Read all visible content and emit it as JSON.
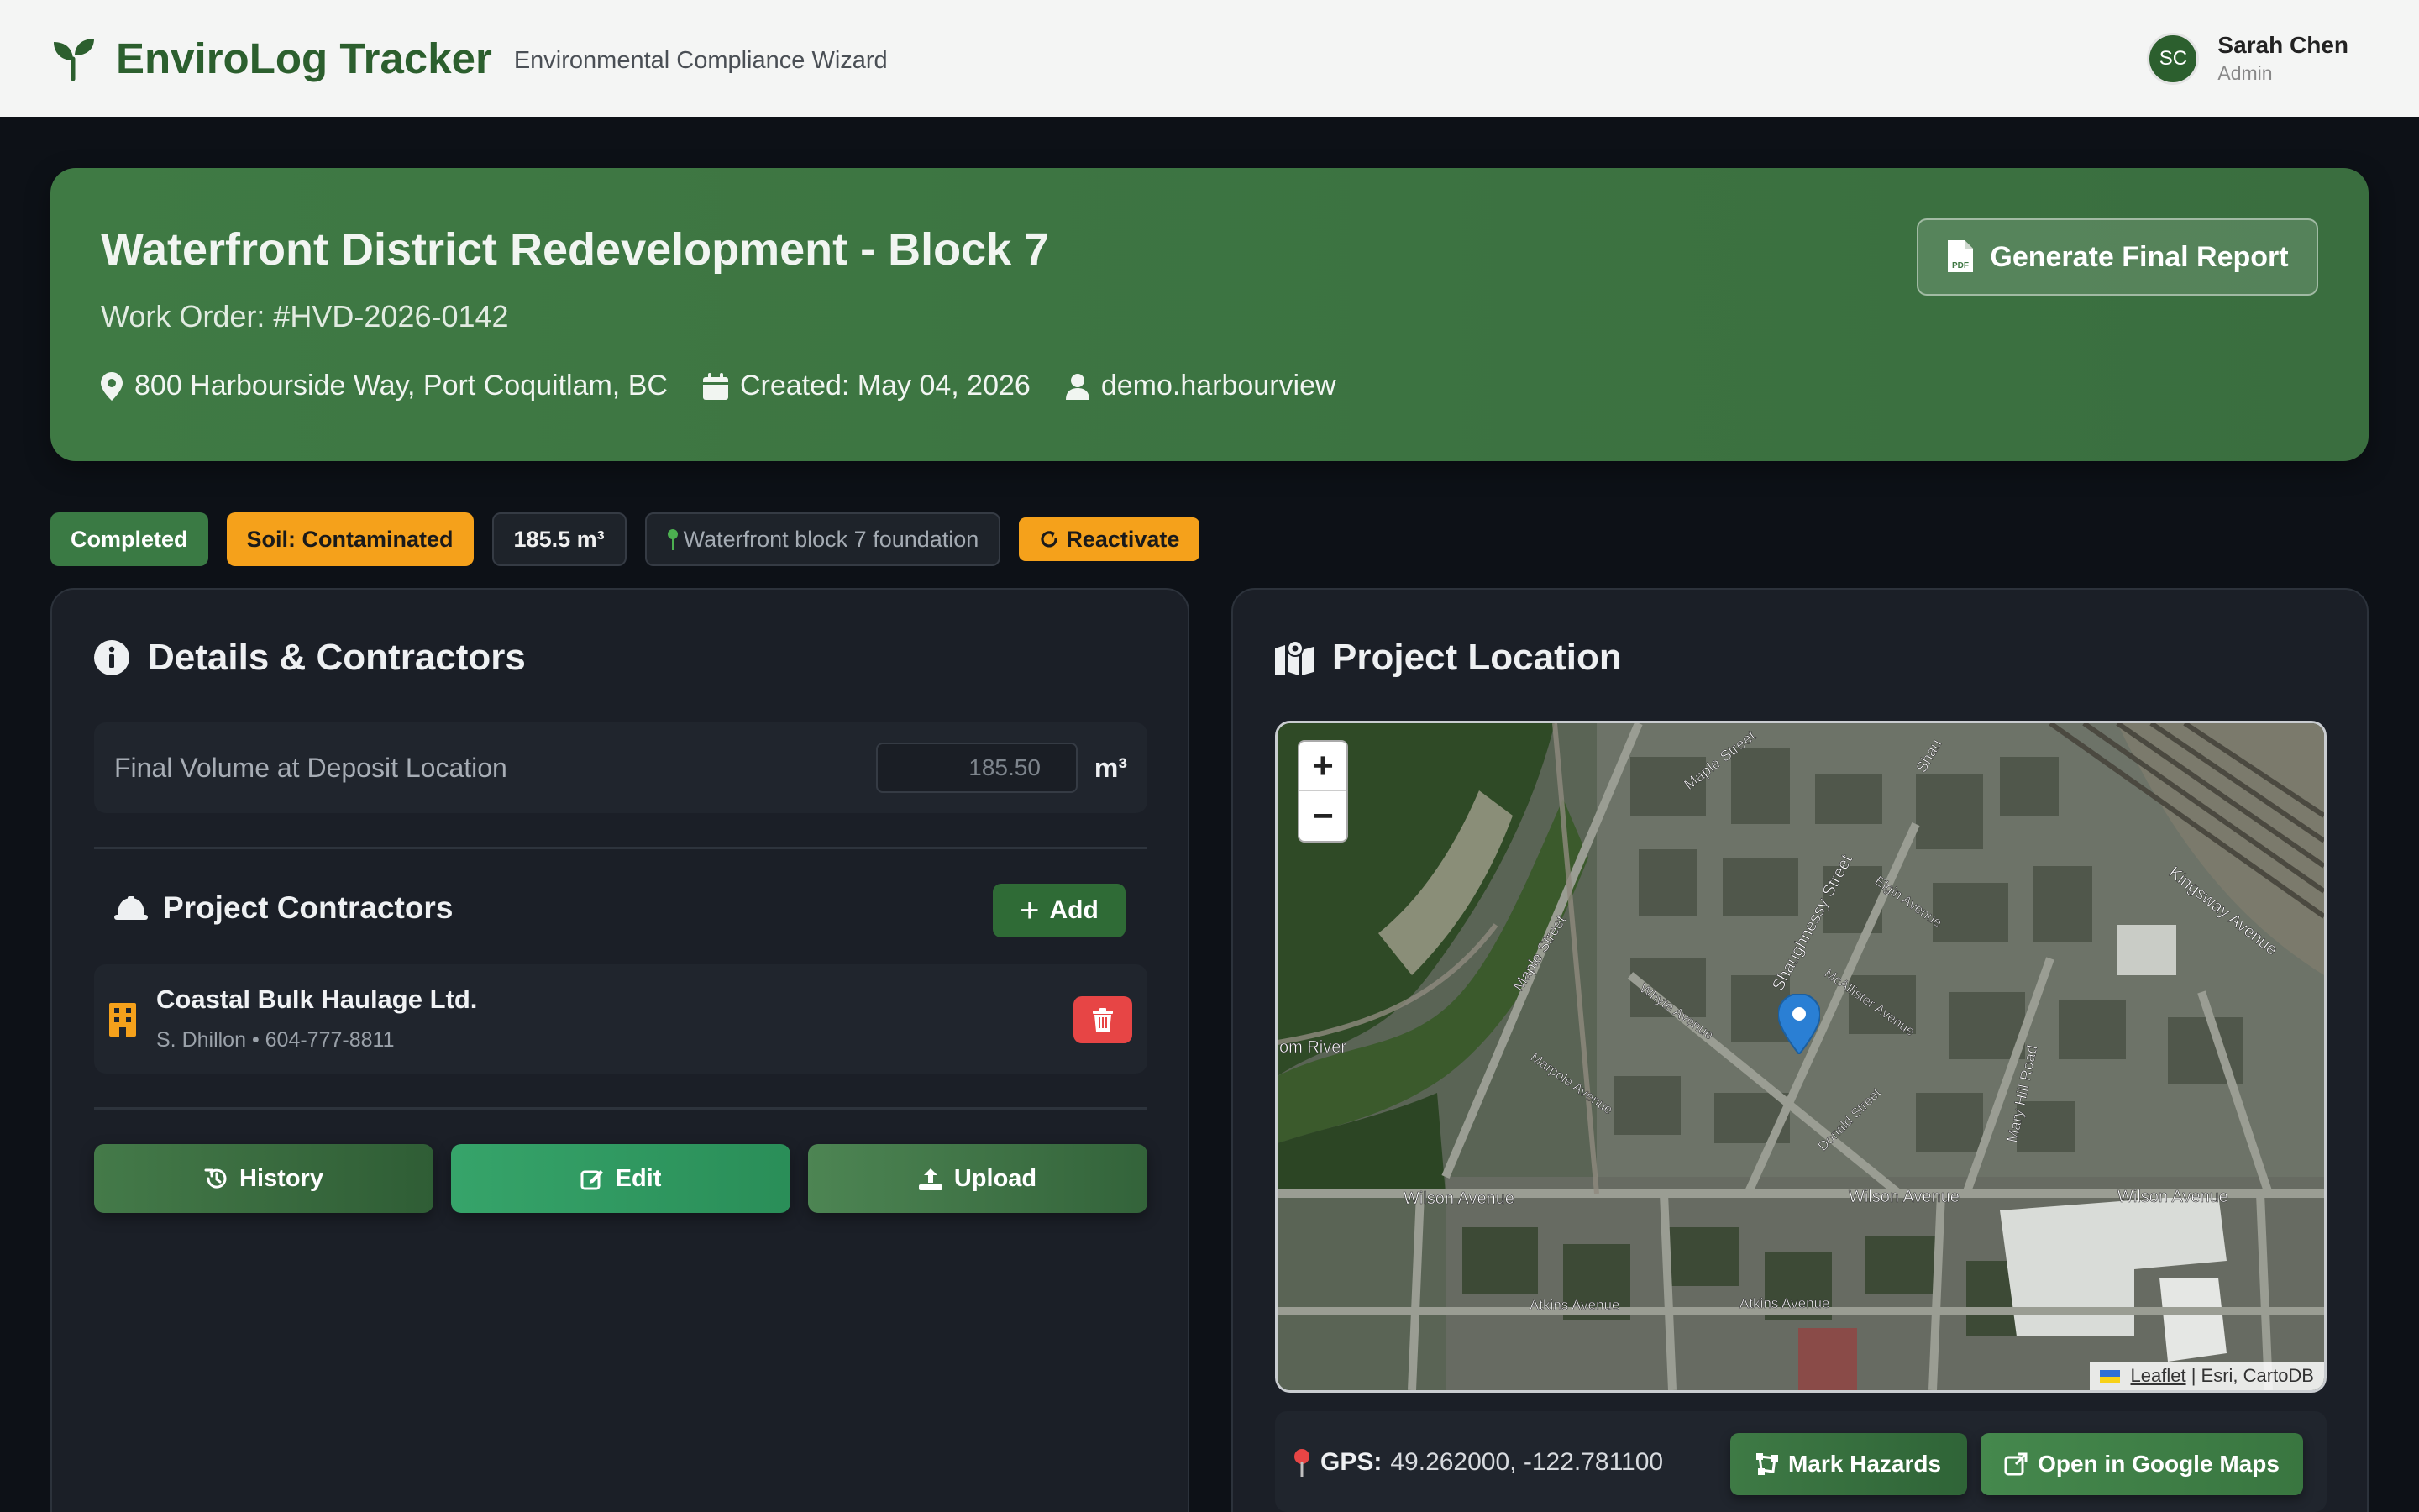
{
  "app": {
    "title": "EnviroLog Tracker",
    "subtitle": "Environmental Compliance Wizard"
  },
  "user": {
    "initials": "SC",
    "name": "Sarah Chen",
    "role": "Admin"
  },
  "project": {
    "title": "Waterfront District Redevelopment - Block 7",
    "work_order": "Work Order: #HVD-2026-0142",
    "address": "800 Harbourside Way, Port Coquitlam, BC",
    "created": "Created: May 04, 2026",
    "owner": "demo.harbourview",
    "report_button": "Generate Final Report"
  },
  "badges": {
    "status": "Completed",
    "soil": "Soil: Contaminated",
    "volume": "185.5 m³",
    "location": "Waterfront block 7 foundation",
    "reactivate": "Reactivate"
  },
  "details": {
    "title": "Details & Contractors",
    "volume_label": "Final Volume at Deposit Location",
    "volume_value": "185.50",
    "volume_unit": "m³",
    "contractors_title": "Project Contractors",
    "add_label": "Add",
    "contractors": [
      {
        "name": "Coastal Bulk Haulage Ltd.",
        "meta": "S. Dhillon • 604-777-8811"
      }
    ],
    "actions": {
      "history": "History",
      "edit": "Edit",
      "upload": "Upload"
    }
  },
  "location": {
    "title": "Project Location",
    "zoom_in": "+",
    "zoom_out": "−",
    "attribution_link": "Leaflet",
    "attribution_rest": "| Esri, CartoDB",
    "streets": {
      "wilson1": "Wilson Avenue",
      "wilson2": "Wilson Avenue",
      "wilson3": "Wilson Avenue",
      "atkins1": "Atkins Avenue",
      "atkins2": "Atkins Avenue",
      "kingsway": "Kingsway Avenue",
      "maple1": "Maple Street",
      "maple2": "Maple Street",
      "shaughnessy": "Shaughnessy Street",
      "elgin": "Elgin Avenue",
      "mcallister": "McAllister Avenue",
      "whyte": "Whyte Avenue",
      "marpole": "Marpole Avenue",
      "donald": "Donald Street",
      "mary_hill": "Mary Hill Road",
      "river": "om River",
      "shau_top": "Shau"
    },
    "gps_label": "GPS:",
    "gps_value": "49.262000, -122.781100",
    "mark_hazards": "Mark Hazards",
    "open_maps": "Open in Google Maps"
  },
  "colors": {
    "brand_green": "#2c5f2e",
    "header_green": "#3f7a44",
    "warning": "#f5a11b",
    "danger": "#e74545"
  }
}
